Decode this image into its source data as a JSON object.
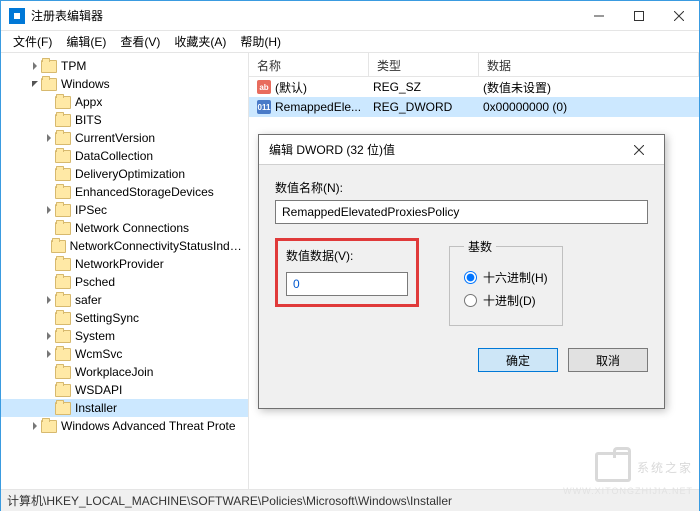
{
  "window": {
    "title": "注册表编辑器"
  },
  "menu": {
    "file": "文件(F)",
    "edit": "编辑(E)",
    "view": "查看(V)",
    "favorites": "收藏夹(A)",
    "help": "帮助(H)"
  },
  "tree": [
    {
      "level": 2,
      "expand": "closed",
      "label": "TPM"
    },
    {
      "level": 2,
      "expand": "open",
      "label": "Windows"
    },
    {
      "level": 3,
      "expand": "none",
      "label": "Appx"
    },
    {
      "level": 3,
      "expand": "none",
      "label": "BITS"
    },
    {
      "level": 3,
      "expand": "closed",
      "label": "CurrentVersion"
    },
    {
      "level": 3,
      "expand": "none",
      "label": "DataCollection"
    },
    {
      "level": 3,
      "expand": "none",
      "label": "DeliveryOptimization"
    },
    {
      "level": 3,
      "expand": "none",
      "label": "EnhancedStorageDevices"
    },
    {
      "level": 3,
      "expand": "closed",
      "label": "IPSec"
    },
    {
      "level": 3,
      "expand": "none",
      "label": "Network Connections"
    },
    {
      "level": 3,
      "expand": "none",
      "label": "NetworkConnectivityStatusIndicator"
    },
    {
      "level": 3,
      "expand": "none",
      "label": "NetworkProvider"
    },
    {
      "level": 3,
      "expand": "none",
      "label": "Psched"
    },
    {
      "level": 3,
      "expand": "closed",
      "label": "safer"
    },
    {
      "level": 3,
      "expand": "none",
      "label": "SettingSync"
    },
    {
      "level": 3,
      "expand": "closed",
      "label": "System"
    },
    {
      "level": 3,
      "expand": "closed",
      "label": "WcmSvc"
    },
    {
      "level": 3,
      "expand": "none",
      "label": "WorkplaceJoin"
    },
    {
      "level": 3,
      "expand": "none",
      "label": "WSDAPI"
    },
    {
      "level": 3,
      "expand": "none",
      "label": "Installer",
      "selected": true
    },
    {
      "level": 2,
      "expand": "closed",
      "label": "Windows Advanced Threat Prote"
    }
  ],
  "list": {
    "cols": {
      "name": "名称",
      "type": "类型",
      "data": "数据"
    },
    "rows": [
      {
        "icon": "sz",
        "name": "(默认)",
        "type": "REG_SZ",
        "data": "(数值未设置)"
      },
      {
        "icon": "dw",
        "name": "RemappedEle...",
        "type": "REG_DWORD",
        "data": "0x00000000 (0)",
        "selected": true
      }
    ]
  },
  "dialog": {
    "title": "编辑 DWORD (32 位)值",
    "name_label": "数值名称(N):",
    "name_value": "RemappedElevatedProxiesPolicy",
    "value_label": "数值数据(V):",
    "value_value": "0",
    "radix_label": "基数",
    "radix_hex": "十六进制(H)",
    "radix_dec": "十进制(D)",
    "ok": "确定",
    "cancel": "取消"
  },
  "statusbar": "计算机\\HKEY_LOCAL_MACHINE\\SOFTWARE\\Policies\\Microsoft\\Windows\\Installer",
  "watermark": {
    "main": "系统之家",
    "sub": "WWW.XITONGZHIJIA.NET"
  }
}
